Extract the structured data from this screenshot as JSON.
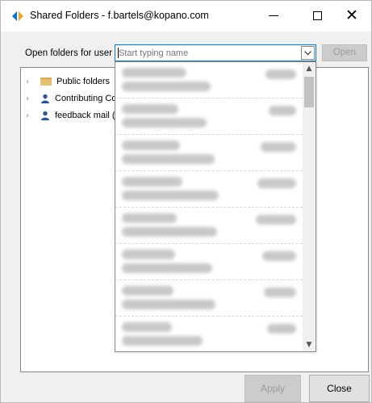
{
  "window": {
    "title": "Shared Folders - f.bartels@kopano.com",
    "controls": {
      "minimize": "minimize-icon",
      "maximize": "maximize-icon",
      "close": "close-icon"
    }
  },
  "open_row": {
    "label": "Open folders for user",
    "input_placeholder": "Start typing name",
    "input_value": "",
    "open_button": "Open"
  },
  "tree": {
    "items": [
      {
        "label": "Public folders",
        "icon": "folder-icon"
      },
      {
        "label": "Contributing Cont",
        "icon": "user-icon"
      },
      {
        "label": "feedback mail (fe",
        "icon": "user-icon"
      }
    ]
  },
  "footer": {
    "apply_button": "Apply",
    "close_button": "Close"
  },
  "colors": {
    "accent": "#0078d7",
    "folder": "#e5c06d",
    "user_icon": "#2b5797",
    "disabled_button": "#cccccc"
  }
}
